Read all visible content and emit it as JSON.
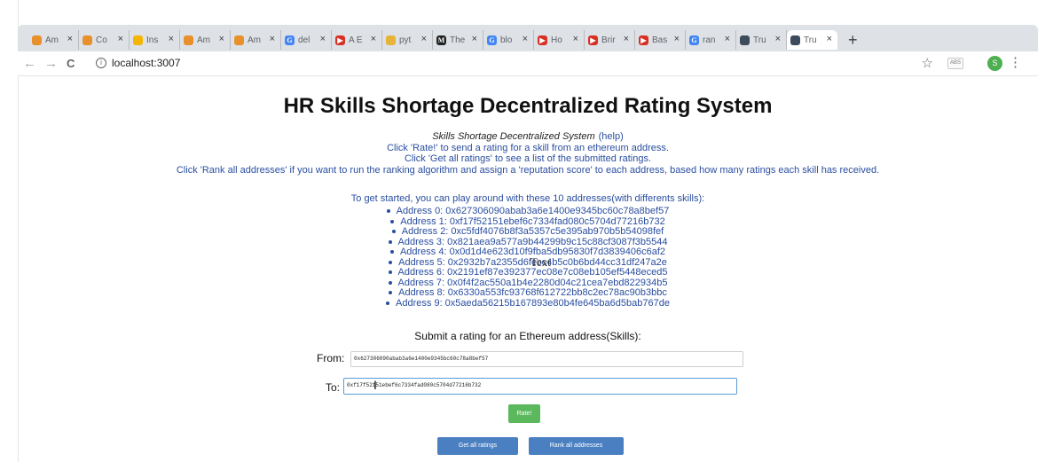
{
  "browser": {
    "tabs": [
      {
        "label": "Am",
        "fav_color": "#e8912c",
        "fav_glyph": ""
      },
      {
        "label": "Co",
        "fav_color": "#e8912c",
        "fav_glyph": ""
      },
      {
        "label": "Ins",
        "fav_color": "#f4b400",
        "fav_glyph": ""
      },
      {
        "label": "Am",
        "fav_color": "#e8912c",
        "fav_glyph": ""
      },
      {
        "label": "Am",
        "fav_color": "#e8912c",
        "fav_glyph": ""
      },
      {
        "label": "del",
        "fav_color": "#4285f4",
        "fav_glyph": "G"
      },
      {
        "label": "A E",
        "fav_color": "#d93025",
        "fav_glyph": "▶"
      },
      {
        "label": "pyt",
        "fav_color": "#e8b339",
        "fav_glyph": ""
      },
      {
        "label": "The",
        "fav_color": "#222222",
        "fav_glyph": "M"
      },
      {
        "label": "blo",
        "fav_color": "#4285f4",
        "fav_glyph": "G"
      },
      {
        "label": "Ho",
        "fav_color": "#d93025",
        "fav_glyph": "▶"
      },
      {
        "label": "Brir",
        "fav_color": "#d93025",
        "fav_glyph": "▶"
      },
      {
        "label": "Bas",
        "fav_color": "#d93025",
        "fav_glyph": "▶"
      },
      {
        "label": "ran",
        "fav_color": "#4285f4",
        "fav_glyph": "G"
      },
      {
        "label": "Tru",
        "fav_color": "#3c4c5c",
        "fav_glyph": ""
      },
      {
        "label": "Tru",
        "fav_color": "#3c4c5c",
        "fav_glyph": ""
      }
    ],
    "active_tab_index": 15,
    "tab_close_glyph": "×",
    "new_tab_glyph": "+",
    "back_glyph": "←",
    "forward_glyph": "→",
    "reload_glyph": "C",
    "info_glyph": "i",
    "url": "localhost:3007",
    "star_glyph": "☆",
    "ext_label": "ABS",
    "profile_initial": "S",
    "menu_glyph": "⋮"
  },
  "page": {
    "title": "HR Skills Shortage Decentralized Rating System",
    "subtitle_main": "Skills Shortage Decentralized System",
    "subtitle_help": "(help)",
    "instructions": [
      "Click 'Rate!' to send a rating for a skill from an ethereum address.",
      "Click 'Get all ratings' to see a list of the submitted ratings.",
      "Click 'Rank all addresses' if you want to run the ranking algorithm and assign a 'reputation score' to each address, based how many ratings each skill has received."
    ],
    "getting_started": "To get started, you can play around with these 10 addresses(with differents skills):",
    "addresses": [
      "Address 0: 0x627306090abab3a6e1400e9345bc60c78a8bef57",
      "Address 1: 0xf17f52151ebef6c7334fad080c5704d77216b732",
      "Address 2: 0xc5fdf4076b8f3a5357c5e395ab970b5b54098fef",
      "Address 3: 0x821aea9a577a9b44299b9c15c88cf3087f3b5544",
      "Address 4: 0x0d1d4e623d10f9fba5db95830f7d3839406c6af2",
      "Address 5: 0x2932b7a2355d6fecc4b5c0b6bd44cc31df247a2e",
      "Address 6: 0x2191ef87e392377ec08e7c08eb105ef5448eced5",
      "Address 7: 0x0f4f2ac550a1b4e2280d04c21cea7ebd822934b5",
      "Address 8: 0x6330a553fc93768f612722bb8c2ec78ac90b3bbc",
      "Address 9: 0x5aeda56215b167893e80b4fe645ba6d5bab767de"
    ],
    "submit_heading": "Submit a rating for an Ethereum address(Skills):",
    "form": {
      "from_label": "From:",
      "from_value": "0x627306090abab3a6e1400e9345bc60c78a8bef57",
      "to_label": "To:",
      "to_value": "0xf17f52151ebef6c7334fad080c5704d77216b732",
      "rate_button": "Rate!",
      "get_all_button": "Get all ratings",
      "rank_all_button": "Rank all addresses"
    },
    "overlay_text": "Text",
    "cursor_glyph": "I"
  }
}
